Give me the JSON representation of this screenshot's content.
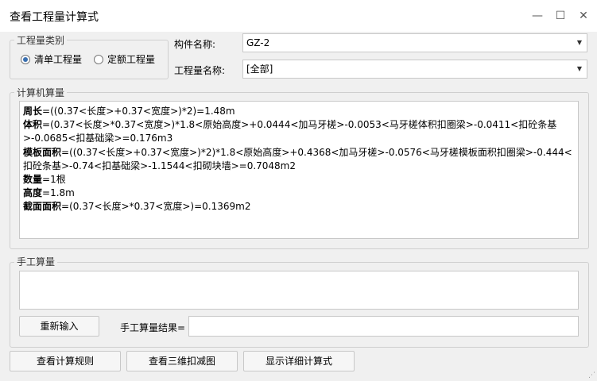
{
  "window": {
    "title": "查看工程量计算式",
    "min_icon": "—",
    "max_icon": "☐",
    "close_icon": "✕"
  },
  "quantity_type": {
    "legend": "工程量类别",
    "options": [
      {
        "label": "清单工程量",
        "selected": true
      },
      {
        "label": "定额工程量",
        "selected": false
      }
    ]
  },
  "component": {
    "label": "构件名称:",
    "value": "GZ-2"
  },
  "quantity_name": {
    "label": "工程量名称:",
    "value": "[全部]"
  },
  "computer_calc": {
    "legend": "计算机算量",
    "lines": [
      {
        "key": "周长",
        "expr": "=((0.37<长度>+0.37<宽度>)*2)=1.48m"
      },
      {
        "key": "体积",
        "expr": "=(0.37<长度>*0.37<宽度>)*1.8<原始高度>+0.0444<加马牙槎>-0.0053<马牙槎体积扣圈梁>-0.0411<扣砼条基>-0.0685<扣基础梁>=0.176m3"
      },
      {
        "key": "模板面积",
        "expr": "=((0.37<长度>+0.37<宽度>)*2)*1.8<原始高度>+0.4368<加马牙槎>-0.0576<马牙槎模板面积扣圈梁>-0.444<扣砼条基>-0.74<扣基础梁>-1.1544<扣砌块墙>=0.7048m2"
      },
      {
        "key": "数量",
        "expr": "=1根"
      },
      {
        "key": "高度",
        "expr": "=1.8m"
      },
      {
        "key": "截面面积",
        "expr": "=(0.37<长度>*0.37<宽度>)=0.1369m2"
      }
    ]
  },
  "manual_calc": {
    "legend": "手工算量",
    "reenter_button": "重新输入",
    "result_label": "手工算量结果="
  },
  "footer": {
    "view_rules": "查看计算规则",
    "view_3d": "查看三维扣减图",
    "show_detail": "显示详细计算式"
  },
  "icons": {
    "dropdown": "chevron-down-icon",
    "resize": "resize-grip-icon"
  }
}
